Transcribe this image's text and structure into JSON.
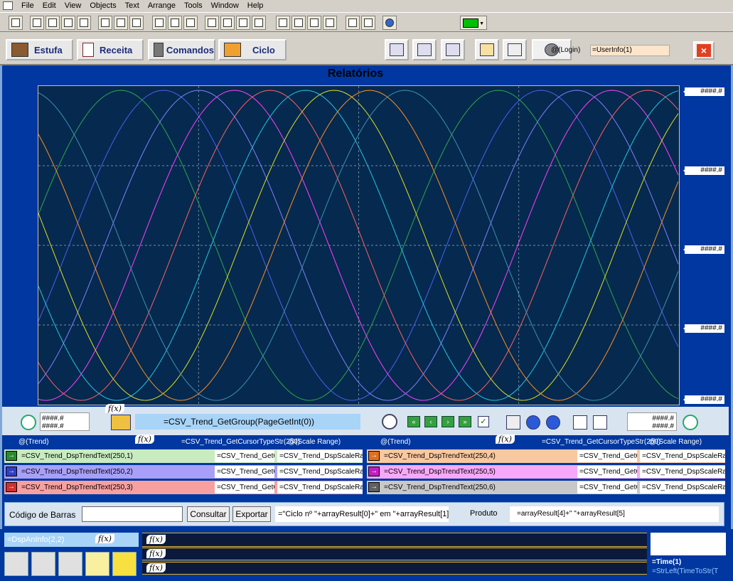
{
  "menu": [
    "File",
    "Edit",
    "View",
    "Objects",
    "Text",
    "Arrange",
    "Tools",
    "Window",
    "Help"
  ],
  "nav": {
    "estufa": "Estufa",
    "receita": "Receita",
    "comandos": "Comandos",
    "ciclo": "Ciclo",
    "login": "@(Login)",
    "userinfo": "=UserInfo(1)",
    "close": "×"
  },
  "title": "Relatórios",
  "yaxis": [
    "####.#",
    "####.#",
    "####.#",
    "####.#",
    "####.#"
  ],
  "ctrl": {
    "left_vals": "####.#\n####.#",
    "right_vals": "####.#\n####.#",
    "group": "=CSV_Trend_GetGroup(PageGetInt(0))",
    "fx": "f(x)"
  },
  "headers": {
    "trend": "@(Trend)",
    "cursor": "=CSV_Trend_GetCursorTypeStr(250)",
    "scale": "@(Scale Range)"
  },
  "pens": [
    {
      "text": "=CSV_Trend_DspTrendText(250,1)",
      "col2": "=CSV_Trend_GetC",
      "col3": "=CSV_Trend_DspScaleRange"
    },
    {
      "text": "=CSV_Trend_DspTrendText(250,2)",
      "col2": "=CSV_Trend_GetC",
      "col3": "=CSV_Trend_DspScaleRange"
    },
    {
      "text": "=CSV_Trend_DspTrendText(250,3)",
      "col2": "=CSV_Trend_GetC",
      "col3": "=CSV_Trend_DspScaleRange"
    },
    {
      "text": "=CSV_Trend_DspTrendText(250,4)",
      "col2": "=CSV_Trend_GetC",
      "col3": "=CSV_Trend_DspScaleRange"
    },
    {
      "text": "=CSV_Trend_DspTrendText(250,5)",
      "col2": "=CSV_Trend_GetC",
      "col3": "=CSV_Trend_DspScaleRange"
    },
    {
      "text": "=CSV_Trend_DspTrendText(250,6)",
      "col2": "=CSV_Trend_GetC",
      "col3": "=CSV_Trend_DspScaleRange"
    }
  ],
  "pen_colors": [
    "#c8ecc0",
    "#a8a0f8",
    "#f8a0a0",
    "#f8c8a0",
    "#f8a8f8",
    "#c8c8c8"
  ],
  "barcode": {
    "label": "Código de Barras",
    "consultar": "Consultar",
    "exportar": "Exportar",
    "ciclo": "=\"Ciclo nº \"+arrayResult[0]+\" em \"+arrayResult[1]",
    "produto": "Produto",
    "prodexpr": "=arrayResult[4]+\" \"+arrayResult[5]"
  },
  "bottom": {
    "dpan": "=DspAnInfo(2,2)",
    "time": "=Time(1)",
    "str": "=StrLeft(TimeToStr(T"
  },
  "curve_colors": [
    "#2ea84a",
    "#4a60f0",
    "#8080ff",
    "#ff40ff",
    "#ff6060",
    "#20c8e0",
    "#e0e020",
    "#ff9020",
    "#4090b0"
  ]
}
